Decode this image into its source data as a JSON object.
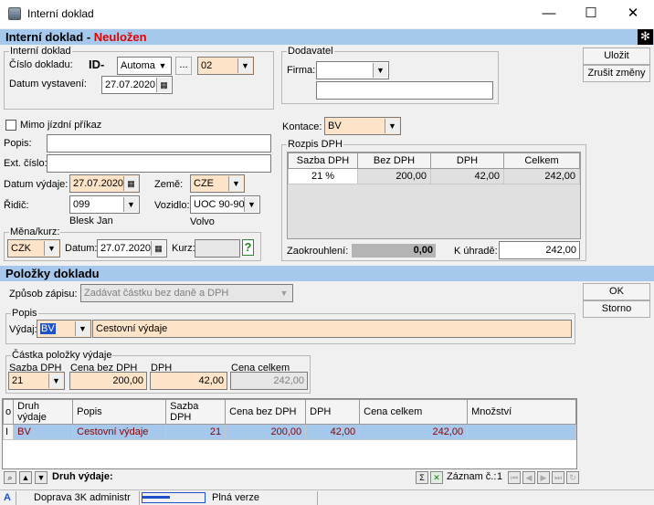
{
  "window": {
    "title": "Interní doklad",
    "minimize_glyph": "—",
    "maximize_glyph": "☐",
    "close_glyph": "✕"
  },
  "header": {
    "title": "Interní doklad",
    "separator": " - ",
    "status": "Neuložen"
  },
  "doklad": {
    "group_label": "Interní doklad",
    "cislo_label": "Číslo dokladu:",
    "id_prefix": "ID-",
    "mode_value": "Automat",
    "ellipsis": "...",
    "series_value": "02",
    "datum_label": "Datum vystavení:",
    "datum_value": "27.07.2020"
  },
  "dodavatel": {
    "group_label": "Dodavatel",
    "firma_label": "Firma:",
    "firma_value": "",
    "firma_name": ""
  },
  "actions": {
    "save": "Uložit",
    "cancel_changes": "Zrušit změny"
  },
  "form": {
    "mimo_label": "Mimo jízdní příkaz",
    "popis_label": "Popis:",
    "popis_value": "",
    "ext_label": "Ext. číslo:",
    "ext_value": "",
    "datum_vydaje_label": "Datum výdaje:",
    "datum_vydaje_value": "27.07.2020",
    "zeme_label": "Země:",
    "zeme_value": "CZE",
    "ridic_label": "Řidič:",
    "ridic_value": "099",
    "ridic_name": "Blesk Jan",
    "vozidlo_label": "Vozidlo:",
    "vozidlo_value": "UOC 90-90",
    "vozidlo_name": "Volvo"
  },
  "mena": {
    "group_label": "Měna/kurz:",
    "currency": "CZK",
    "datum_label": "Datum:",
    "datum_value": "27.07.2020",
    "kurz_label": "Kurz:",
    "kurz_value": "",
    "help_glyph": "?"
  },
  "kontace": {
    "label": "Kontace:",
    "value": "BV"
  },
  "rozpis": {
    "group_label": "Rozpis DPH",
    "columns": [
      "Sazba DPH",
      "Bez DPH",
      "DPH",
      "Celkem"
    ],
    "rows": [
      [
        "21 %",
        "200,00",
        "42,00",
        "242,00"
      ]
    ],
    "zaokrouhleni_label": "Zaokrouhlení:",
    "zaokrouhleni_value": "0,00",
    "k_uhrade_label": "K úhradě:",
    "k_uhrade_value": "242,00"
  },
  "polozky": {
    "title": "Položky dokladu",
    "zpusob_label": "Způsob zápisu:",
    "zpusob_value": "Zadávat částku bez daně a DPH",
    "ok": "OK",
    "storno": "Storno",
    "popis_group": "Popis",
    "vydaj_label": "Výdaj:",
    "vydaj_code": "BV",
    "vydaj_text": "Cestovní výdaje",
    "castka_group": "Částka položky výdaje",
    "sazba_label": "Sazba DPH",
    "sazba_value": "21",
    "cena_bez_label": "Cena bez DPH",
    "cena_bez_value": "200,00",
    "dph_label": "DPH",
    "dph_value": "42,00",
    "cena_celkem_label": "Cena celkem",
    "cena_celkem_value": "242,00"
  },
  "items_table": {
    "marker_header": "o",
    "columns": [
      "Druh výdaje",
      "Popis",
      "Sazba DPH",
      "Cena bez DPH",
      "DPH",
      "Cena celkem",
      "Množství"
    ],
    "rows": [
      {
        "marker": "I",
        "cells": [
          "BV",
          "Cestovní výdaje",
          "21",
          "200,00",
          "42,00",
          "242,00",
          ""
        ]
      }
    ]
  },
  "footer": {
    "druh_label": "Druh výdaje:",
    "sigma": "Σ",
    "zaznam_label": "Záznam č.:",
    "zaznam_value": "1"
  },
  "statusbar": {
    "mode": "A",
    "user": "Doprava 3K administr",
    "version": "Plná verze"
  },
  "colors": {
    "band": "#a6c8ec",
    "peach": "#fde4c8",
    "status_red": "#e00000",
    "selected_row": "#a6c8ec",
    "row_text": "#8b0000"
  }
}
